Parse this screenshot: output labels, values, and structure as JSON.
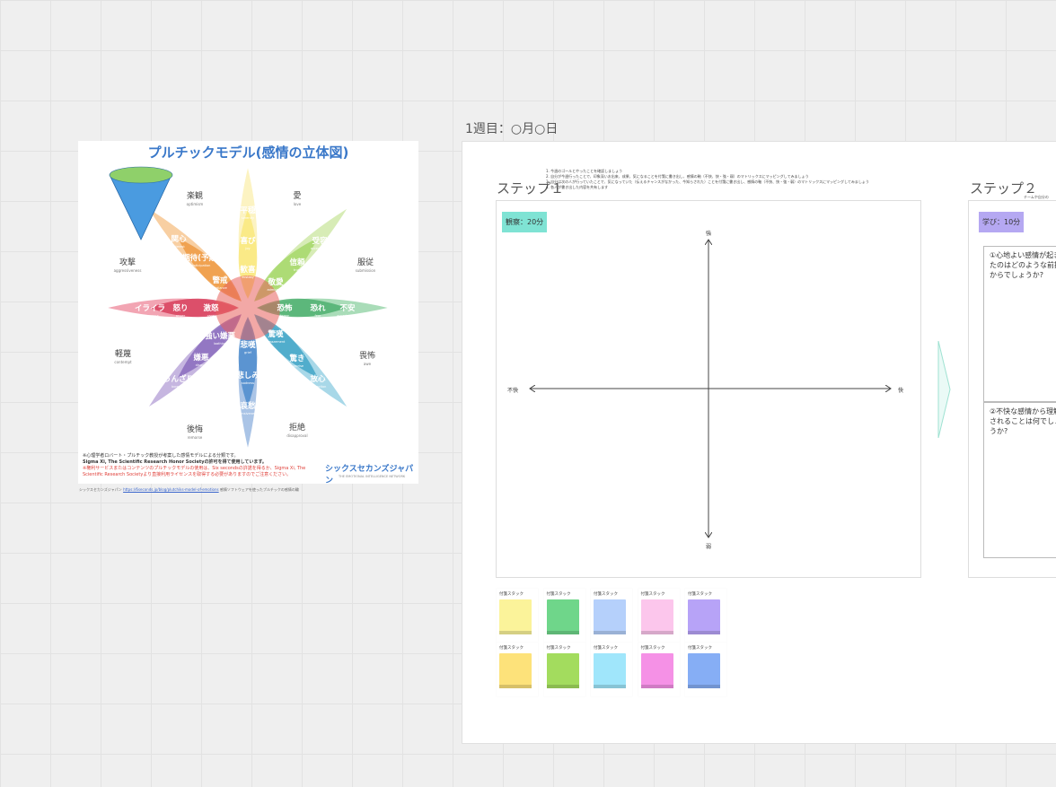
{
  "frame_title": "1週目：○月○日",
  "image_card": {
    "title": "プルチックモデル(感情の立体図)",
    "petals": [
      {
        "label": "楽観",
        "en": "optimism"
      },
      {
        "label": "愛",
        "en": "love"
      },
      {
        "label": "服従",
        "en": "submission"
      },
      {
        "label": "畏怖",
        "en": "awe"
      },
      {
        "label": "拒絶",
        "en": "disapproval"
      },
      {
        "label": "後悔",
        "en": "remorse"
      },
      {
        "label": "軽蔑",
        "en": "contempt"
      },
      {
        "label": "攻撃",
        "en": "aggressiveness"
      }
    ],
    "inner": [
      {
        "label": "平穏",
        "en": "serenity"
      },
      {
        "label": "喜び",
        "en": "joy"
      },
      {
        "label": "歓喜",
        "en": "ecstasy"
      },
      {
        "label": "受容",
        "en": "acceptance"
      },
      {
        "label": "信頼",
        "en": "trust"
      },
      {
        "label": "敬愛",
        "en": "admiration"
      },
      {
        "label": "恐れ",
        "en": "fear"
      },
      {
        "label": "不安",
        "en": "apprehension"
      },
      {
        "label": "恐怖",
        "en": "terror"
      },
      {
        "label": "驚き",
        "en": "surprise"
      },
      {
        "label": "放心",
        "en": "distraction"
      },
      {
        "label": "驚嘆",
        "en": "amazement"
      },
      {
        "label": "悲しみ",
        "en": "sadness"
      },
      {
        "label": "哀愁",
        "en": "pensiveness"
      },
      {
        "label": "悲嘆",
        "en": "grief"
      },
      {
        "label": "嫌悪",
        "en": "disgust"
      },
      {
        "label": "うんざり",
        "en": "boredom"
      },
      {
        "label": "強い嫌悪",
        "en": "loathing"
      },
      {
        "label": "怒り",
        "en": "anger"
      },
      {
        "label": "イライラ",
        "en": "annoyance"
      },
      {
        "label": "激怒",
        "en": "rage"
      },
      {
        "label": "期待(予期)",
        "en": "anticipation"
      },
      {
        "label": "関心",
        "en": "interest"
      },
      {
        "label": "警戒",
        "en": "vigilance"
      }
    ],
    "note_line1": "※心理学者ロバート・プルチック教授が考案した感情モデルによる分類です。",
    "note_line2": "Sigma Xi, The Scientific Research Honor Societyの許可を得て使用しています。",
    "note_red": "※権利サービスまたはコンテンツのプルチックモデルの使用は、Six secondsの許諾を得るか、Sigma Xi, The Scientific Research Societyより直接利用ライセンスを取得する必要がありますのでご注意ください。",
    "brand": "シックスセカンズジャパン",
    "brand_sub": "THE EMOTIONAL INTELLIGENCE NETWORK",
    "credit_prefix": "シックスセカンズジャパン",
    "credit_link": "https://6seconds.jp/blog/plutchiks-model-of-emotions",
    "credit_suffix": "感情ソフトウェアを使ったプルチックの感情の輪"
  },
  "step1": {
    "title": "ステップ１",
    "tag": "観察：20分",
    "instructions": [
      "1. 今週のゴールとやったことを確認しましょう",
      "2. 自分が今週行ったことで、印象深いお出来、成果、気になることを付箋に書き出し、感情の軸（不快、快・強・弱）のマトリックスにマッピングしてみましょう",
      "3. 自分は次の人が行っていたことで、気になっていた（伝えるチャンスがなかった、今知らされた）ことを付箋に書き出し、感情の軸（不快、快・強・弱）のマトリックスにマッピングしてみましょう",
      "4. 各人が書き出した内容を共有します"
    ],
    "axis": {
      "strong": "強",
      "weak": "弱",
      "unpleasant": "不快",
      "pleasant": "快"
    }
  },
  "step2": {
    "title": "ステップ２",
    "tag": "学び：10分",
    "note": "チームや自分の",
    "q1": "①心地よい感情が起きたのはどのような前提からでしょうか?",
    "q2": "②不快な感情から理解されることは何でしょうか?"
  },
  "sticky_label": "付箋スタック",
  "sticky_colors": {
    "row1": [
      "#fbf39a",
      "#6fd68a",
      "#b5d0fb",
      "#fcc6ec",
      "#b7a3f7"
    ],
    "row2": [
      "#fde27a",
      "#a3dc5e",
      "#a0e6fb",
      "#f591e6",
      "#86aef5"
    ]
  }
}
